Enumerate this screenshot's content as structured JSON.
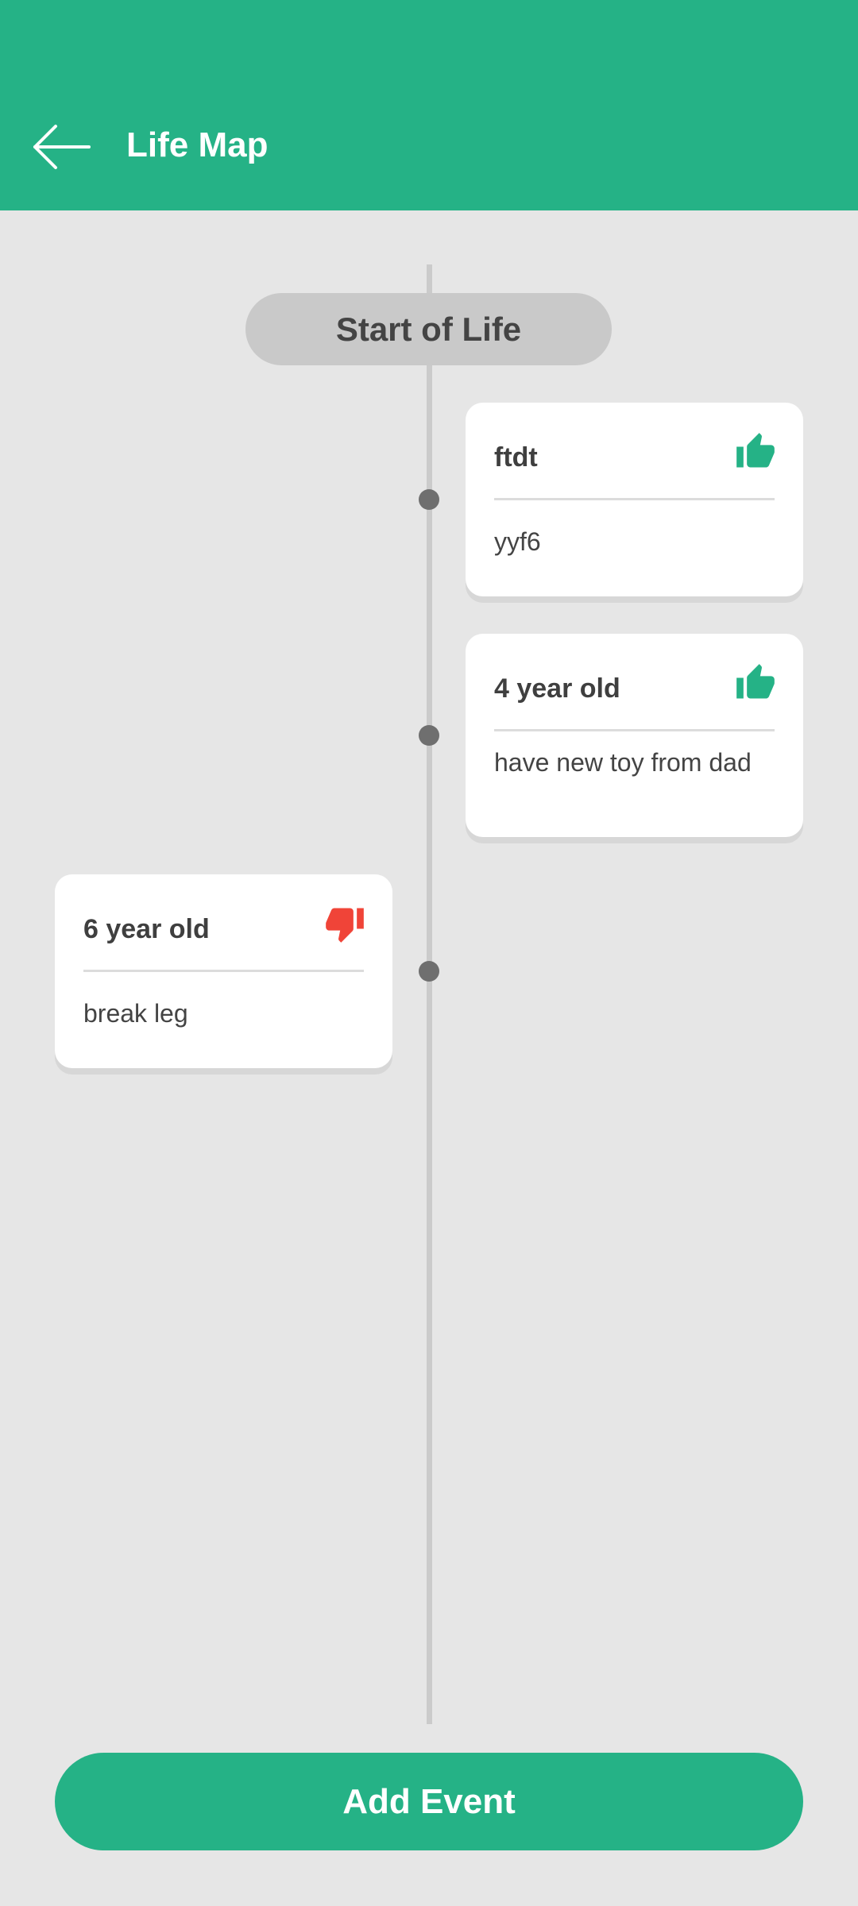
{
  "appbar": {
    "title": "Life Map",
    "back_icon": "arrow-left-icon",
    "color": "#25b286"
  },
  "timeline": {
    "start_label": "Start of Life"
  },
  "events": [
    {
      "title": "ftdt",
      "description": "yyf6",
      "sentiment": "positive",
      "icon": "thumbs-up-icon",
      "icon_color": "#25b286"
    },
    {
      "title": "4 year old",
      "description": "have new toy from dad",
      "sentiment": "positive",
      "icon": "thumbs-up-icon",
      "icon_color": "#25b286"
    },
    {
      "title": "6 year old",
      "description": "break leg",
      "sentiment": "negative",
      "icon": "thumbs-down-icon",
      "icon_color": "#f04438"
    }
  ],
  "footer": {
    "add_button_label": "Add Event"
  }
}
